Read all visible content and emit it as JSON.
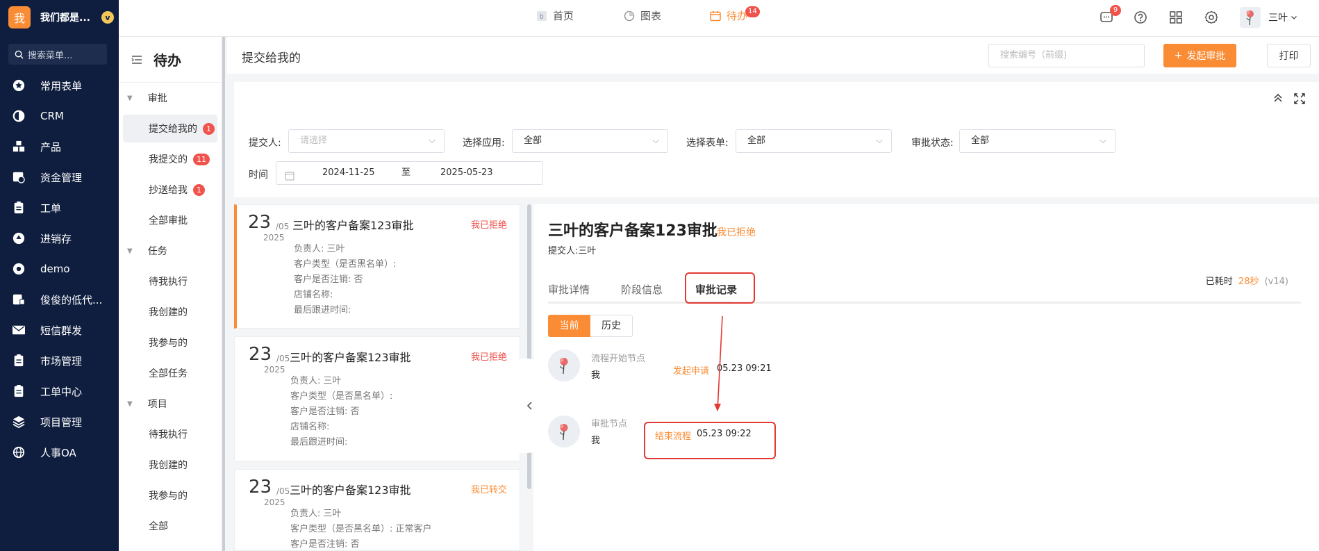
{
  "nav": {
    "logo": "我",
    "company": "我们都是...",
    "verify": "v",
    "search_placeholder": "搜索菜单...",
    "items": [
      {
        "label": "常用表单",
        "icon": "star-icon"
      },
      {
        "label": "CRM",
        "icon": "pie-icon"
      },
      {
        "label": "产品",
        "icon": "boxes-icon"
      },
      {
        "label": "资金管理",
        "icon": "money-icon"
      },
      {
        "label": "工单",
        "icon": "clipboard-icon"
      },
      {
        "label": "进销存",
        "icon": "cycle-icon"
      },
      {
        "label": "demo",
        "icon": "gear-icon"
      },
      {
        "label": "俊俊的低代...",
        "icon": "form-icon"
      },
      {
        "label": "短信群发",
        "icon": "mail-icon"
      },
      {
        "label": "市场管理",
        "icon": "clipboard-icon"
      },
      {
        "label": "工单中心",
        "icon": "clipboard-icon"
      },
      {
        "label": "项目管理",
        "icon": "layers-icon"
      },
      {
        "label": "人事OA",
        "icon": "globe-icon"
      }
    ]
  },
  "top": {
    "tabs": [
      {
        "label": "首页"
      },
      {
        "label": "图表"
      },
      {
        "label": "待办",
        "badge": "14"
      }
    ],
    "msg_badge": "9",
    "user": "三叶"
  },
  "sub": {
    "title": "待办",
    "groups": [
      {
        "label": "审批",
        "items": [
          {
            "label": "提交给我的",
            "count": "1"
          },
          {
            "label": "我提交的",
            "count": "11"
          },
          {
            "label": "抄送给我",
            "count": "1"
          },
          {
            "label": "全部审批",
            "count": ""
          }
        ]
      },
      {
        "label": "任务",
        "items": [
          {
            "label": "待我执行"
          },
          {
            "label": "我创建的"
          },
          {
            "label": "我参与的"
          },
          {
            "label": "全部任务"
          }
        ]
      },
      {
        "label": "项目",
        "items": [
          {
            "label": "待我执行"
          },
          {
            "label": "我创建的"
          },
          {
            "label": "我参与的"
          },
          {
            "label": "全部"
          }
        ]
      }
    ]
  },
  "header": {
    "title": "提交给我的",
    "search_placeholder": "搜索编号（前缀)",
    "primary": "发起审批",
    "print": "打印"
  },
  "filter": {
    "submitter_label": "提交人:",
    "submitter_placeholder": "请选择",
    "app_label": "选择应用:",
    "app_value": "全部",
    "form_label": "选择表单:",
    "form_value": "全部",
    "status_label": "审批状态:",
    "status_value": "全部",
    "time_label": "时间",
    "start": "2024-11-25",
    "sep": "至",
    "end": "2025-05-23"
  },
  "cards": [
    {
      "day": "23",
      "mon": "/05",
      "yr": "2025",
      "title": "三叶的客户备案123审批",
      "status": "我已拒绝",
      "fields": [
        "负责人: 三叶",
        "客户类型（是否黑名单）:",
        "客户是否注销: 否",
        "店铺名称:",
        "最后跟进时间:"
      ]
    },
    {
      "day": "23",
      "mon": "/05",
      "yr": "2025",
      "title": "三叶的客户备案123审批",
      "status": "我已拒绝",
      "fields": [
        "负责人: 三叶",
        "客户类型（是否黑名单）:",
        "客户是否注销: 否",
        "店铺名称:",
        "最后跟进时间:"
      ]
    },
    {
      "day": "23",
      "mon": "/05",
      "yr": "2025",
      "title": "三叶的客户备案123审批",
      "status": "我已转交",
      "fields": [
        "负责人: 三叶",
        "客户类型（是否黑名单）: 正常客户",
        "客户是否注销: 否"
      ]
    }
  ],
  "detail": {
    "title": "三叶的客户备案123审批",
    "status": "我已拒绝",
    "submitter": "提交人:三叶",
    "tabs": [
      "审批详情",
      "阶段信息",
      "审批记录"
    ],
    "timer_label": "已耗时",
    "timer_value": "28秒",
    "version": "(v14)",
    "seg_current": "当前",
    "seg_history": "历史",
    "records": [
      {
        "node": "流程开始节点",
        "who": "我",
        "action": "发起申请",
        "time": "05.23 09:21"
      },
      {
        "node": "审批节点",
        "who": "我",
        "action": "结束流程",
        "time": "05.23 09:22"
      }
    ]
  },
  "colors": {
    "accent": "#fa8c35",
    "nav_bg": "#0f1e3f",
    "danger": "#f0524c",
    "annotation": "#e23a31"
  }
}
